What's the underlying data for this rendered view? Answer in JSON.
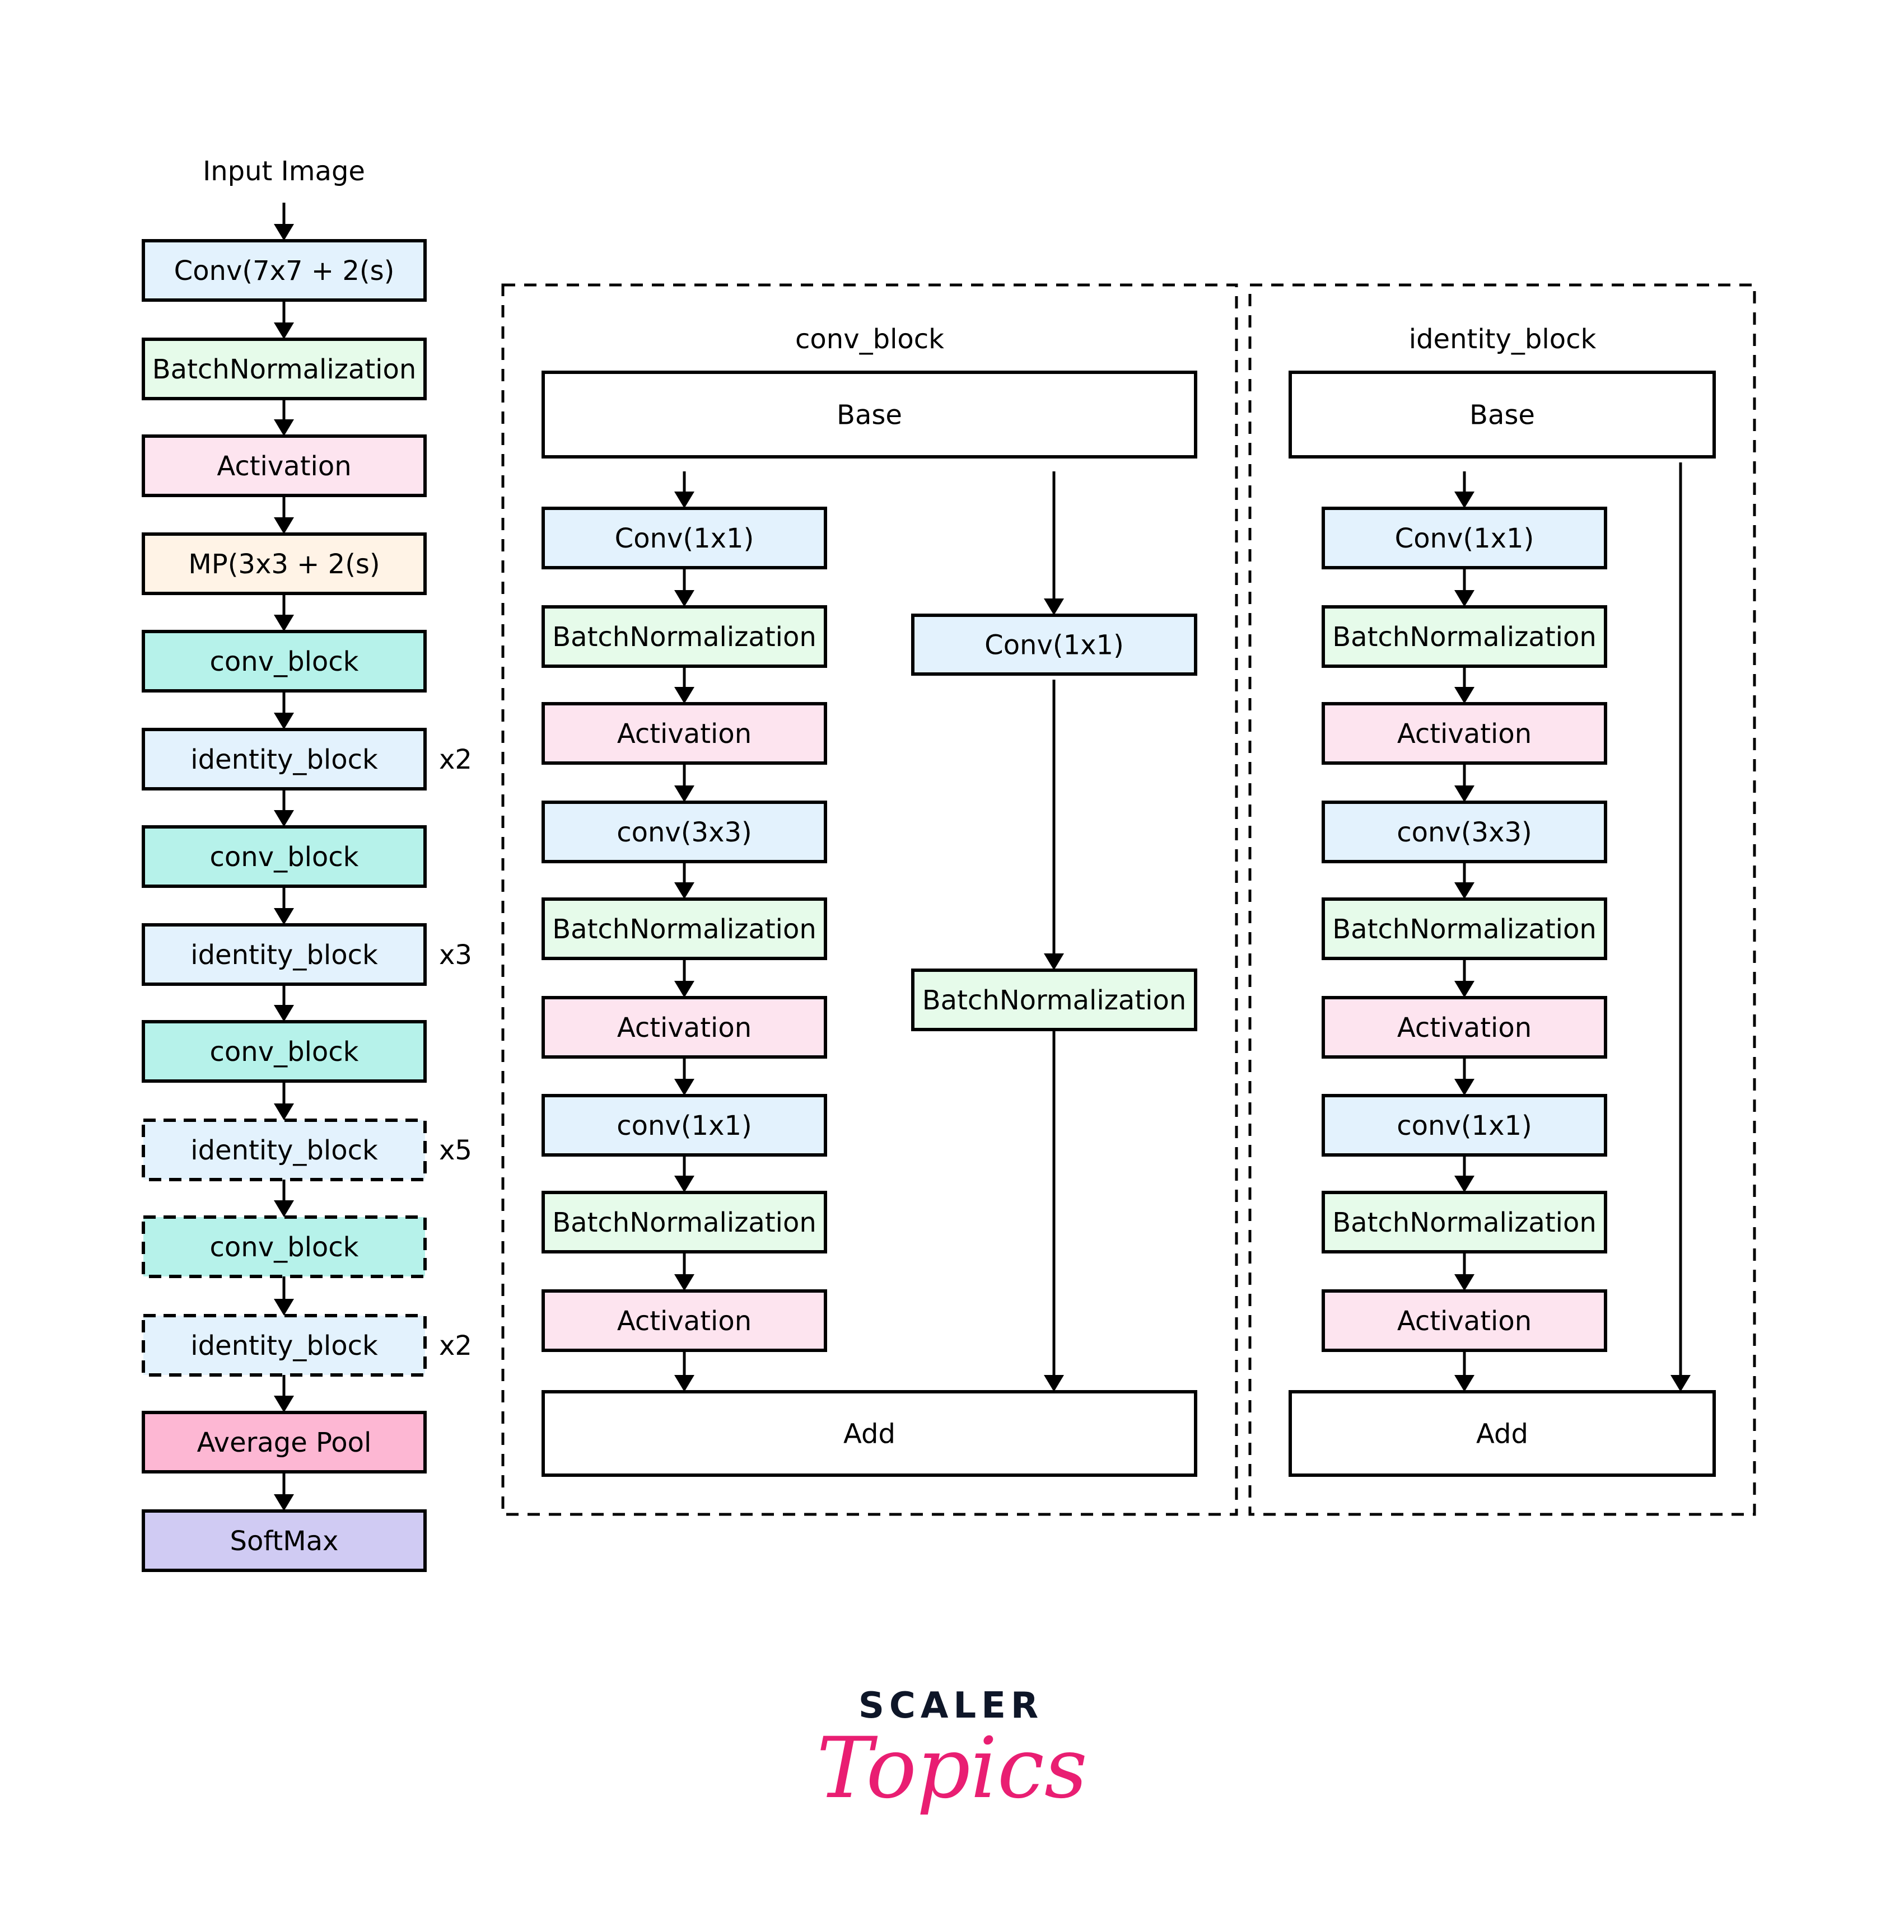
{
  "colors": {
    "conv": "#e3f2fd",
    "batchnorm": "#e6fbea",
    "activation": "#fde4ef",
    "maxpool": "#fff3e6",
    "conv_block": "#b6f2ea",
    "identity_block": "#e3f2fd",
    "average_pool": "#fdb7d3",
    "softmax": "#d0cbf3",
    "plain": "#ffffff",
    "logo_dark": "#0e1628",
    "logo_pink": "#e91e72"
  },
  "main_pipeline": {
    "input_label": "Input Image",
    "nodes": [
      {
        "label": "Conv(7x7 + 2(s)",
        "kind": "conv",
        "dashed": false,
        "repeat": ""
      },
      {
        "label": "BatchNormalization",
        "kind": "batchnorm",
        "dashed": false,
        "repeat": ""
      },
      {
        "label": "Activation",
        "kind": "activation",
        "dashed": false,
        "repeat": ""
      },
      {
        "label": "MP(3x3 + 2(s)",
        "kind": "maxpool",
        "dashed": false,
        "repeat": ""
      },
      {
        "label": "conv_block",
        "kind": "conv_block",
        "dashed": false,
        "repeat": ""
      },
      {
        "label": "identity_block",
        "kind": "identity_block",
        "dashed": false,
        "repeat": "x2"
      },
      {
        "label": "conv_block",
        "kind": "conv_block",
        "dashed": false,
        "repeat": ""
      },
      {
        "label": "identity_block",
        "kind": "identity_block",
        "dashed": false,
        "repeat": "x3"
      },
      {
        "label": "conv_block",
        "kind": "conv_block",
        "dashed": false,
        "repeat": ""
      },
      {
        "label": "identity_block",
        "kind": "identity_block",
        "dashed": true,
        "repeat": "x5"
      },
      {
        "label": "conv_block",
        "kind": "conv_block",
        "dashed": true,
        "repeat": ""
      },
      {
        "label": "identity_block",
        "kind": "identity_block",
        "dashed": true,
        "repeat": "x2"
      },
      {
        "label": "Average Pool",
        "kind": "average_pool",
        "dashed": false,
        "repeat": ""
      },
      {
        "label": "SoftMax",
        "kind": "softmax",
        "dashed": false,
        "repeat": ""
      }
    ]
  },
  "conv_block_panel": {
    "title": "conv_block",
    "base_label": "Base",
    "add_label": "Add",
    "main_path": [
      {
        "label": "Conv(1x1)",
        "kind": "conv"
      },
      {
        "label": "BatchNormalization",
        "kind": "batchnorm"
      },
      {
        "label": "Activation",
        "kind": "activation"
      },
      {
        "label": "conv(3x3)",
        "kind": "conv"
      },
      {
        "label": "BatchNormalization",
        "kind": "batchnorm"
      },
      {
        "label": "Activation",
        "kind": "activation"
      },
      {
        "label": "conv(1x1)",
        "kind": "conv"
      },
      {
        "label": "BatchNormalization",
        "kind": "batchnorm"
      },
      {
        "label": "Activation",
        "kind": "activation"
      }
    ],
    "shortcut_path": [
      {
        "label": "Conv(1x1)",
        "kind": "conv"
      },
      {
        "label": "BatchNormalization",
        "kind": "batchnorm"
      }
    ]
  },
  "identity_block_panel": {
    "title": "identity_block",
    "base_label": "Base",
    "add_label": "Add",
    "main_path": [
      {
        "label": "Conv(1x1)",
        "kind": "conv"
      },
      {
        "label": "BatchNormalization",
        "kind": "batchnorm"
      },
      {
        "label": "Activation",
        "kind": "activation"
      },
      {
        "label": "conv(3x3)",
        "kind": "conv"
      },
      {
        "label": "BatchNormalization",
        "kind": "batchnorm"
      },
      {
        "label": "Activation",
        "kind": "activation"
      },
      {
        "label": "conv(1x1)",
        "kind": "conv"
      },
      {
        "label": "BatchNormalization",
        "kind": "batchnorm"
      },
      {
        "label": "Activation",
        "kind": "activation"
      }
    ],
    "shortcut_path": []
  },
  "logo": {
    "top_text": "SCALER",
    "bottom_text": "Topics"
  }
}
